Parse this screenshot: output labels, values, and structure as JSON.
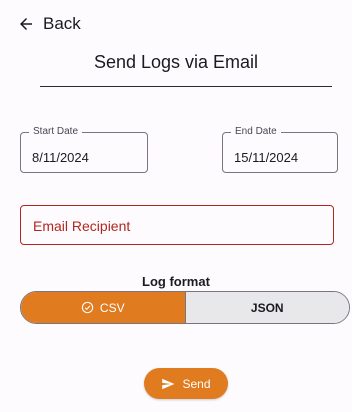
{
  "header": {
    "back_label": "Back",
    "title": "Send Logs via Email"
  },
  "date_range": {
    "start": {
      "label": "Start Date",
      "value": "8/11/2024"
    },
    "end": {
      "label": "End Date",
      "value": "15/11/2024"
    }
  },
  "email": {
    "placeholder": "Email Recipient"
  },
  "log_format": {
    "label": "Log format",
    "options": [
      {
        "label": "CSV",
        "selected": true
      },
      {
        "label": "JSON",
        "selected": false
      }
    ]
  },
  "actions": {
    "send_label": "Send"
  },
  "colors": {
    "accent": "#e07b20",
    "error": "#b3261e",
    "unselected_segment": "#e8e7ea"
  },
  "icons": {
    "back": "arrow-left-icon",
    "selected": "check-circle-icon",
    "send": "send-icon"
  }
}
